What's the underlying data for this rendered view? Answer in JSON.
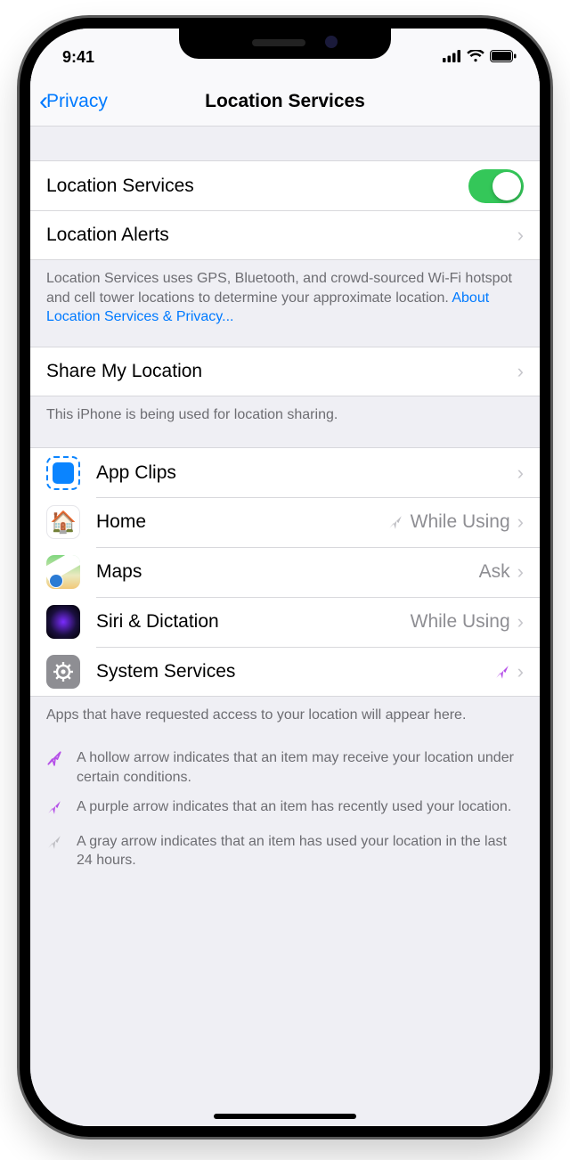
{
  "status": {
    "time": "9:41"
  },
  "nav": {
    "back_label": "Privacy",
    "title": "Location Services"
  },
  "main_toggle": {
    "label": "Location Services",
    "on": true
  },
  "alerts_row": {
    "label": "Location Alerts"
  },
  "about_footer": {
    "text": "Location Services uses GPS, Bluetooth, and crowd-sourced Wi-Fi hotspot and cell tower locations to determine your approximate location. ",
    "link": "About Location Services & Privacy..."
  },
  "share_row": {
    "label": "Share My Location"
  },
  "share_footer": "This iPhone is being used for location sharing.",
  "apps": [
    {
      "name": "App Clips",
      "value": "",
      "indicator": "none",
      "icon": "appclips"
    },
    {
      "name": "Home",
      "value": "While Using",
      "indicator": "gray",
      "icon": "home"
    },
    {
      "name": "Maps",
      "value": "Ask",
      "indicator": "none",
      "icon": "maps"
    },
    {
      "name": "Siri & Dictation",
      "value": "While Using",
      "indicator": "none",
      "icon": "siri"
    },
    {
      "name": "System Services",
      "value": "",
      "indicator": "purple",
      "icon": "sys"
    }
  ],
  "apps_footer": "Apps that have requested access to your location will appear here.",
  "legend": [
    {
      "style": "hollow-purple",
      "text": "A hollow arrow indicates that an item may receive your location under certain conditions."
    },
    {
      "style": "purple",
      "text": "A purple arrow indicates that an item has recently used your location."
    },
    {
      "style": "gray",
      "text": "A gray arrow indicates that an item has used your location in the last 24 hours."
    }
  ]
}
